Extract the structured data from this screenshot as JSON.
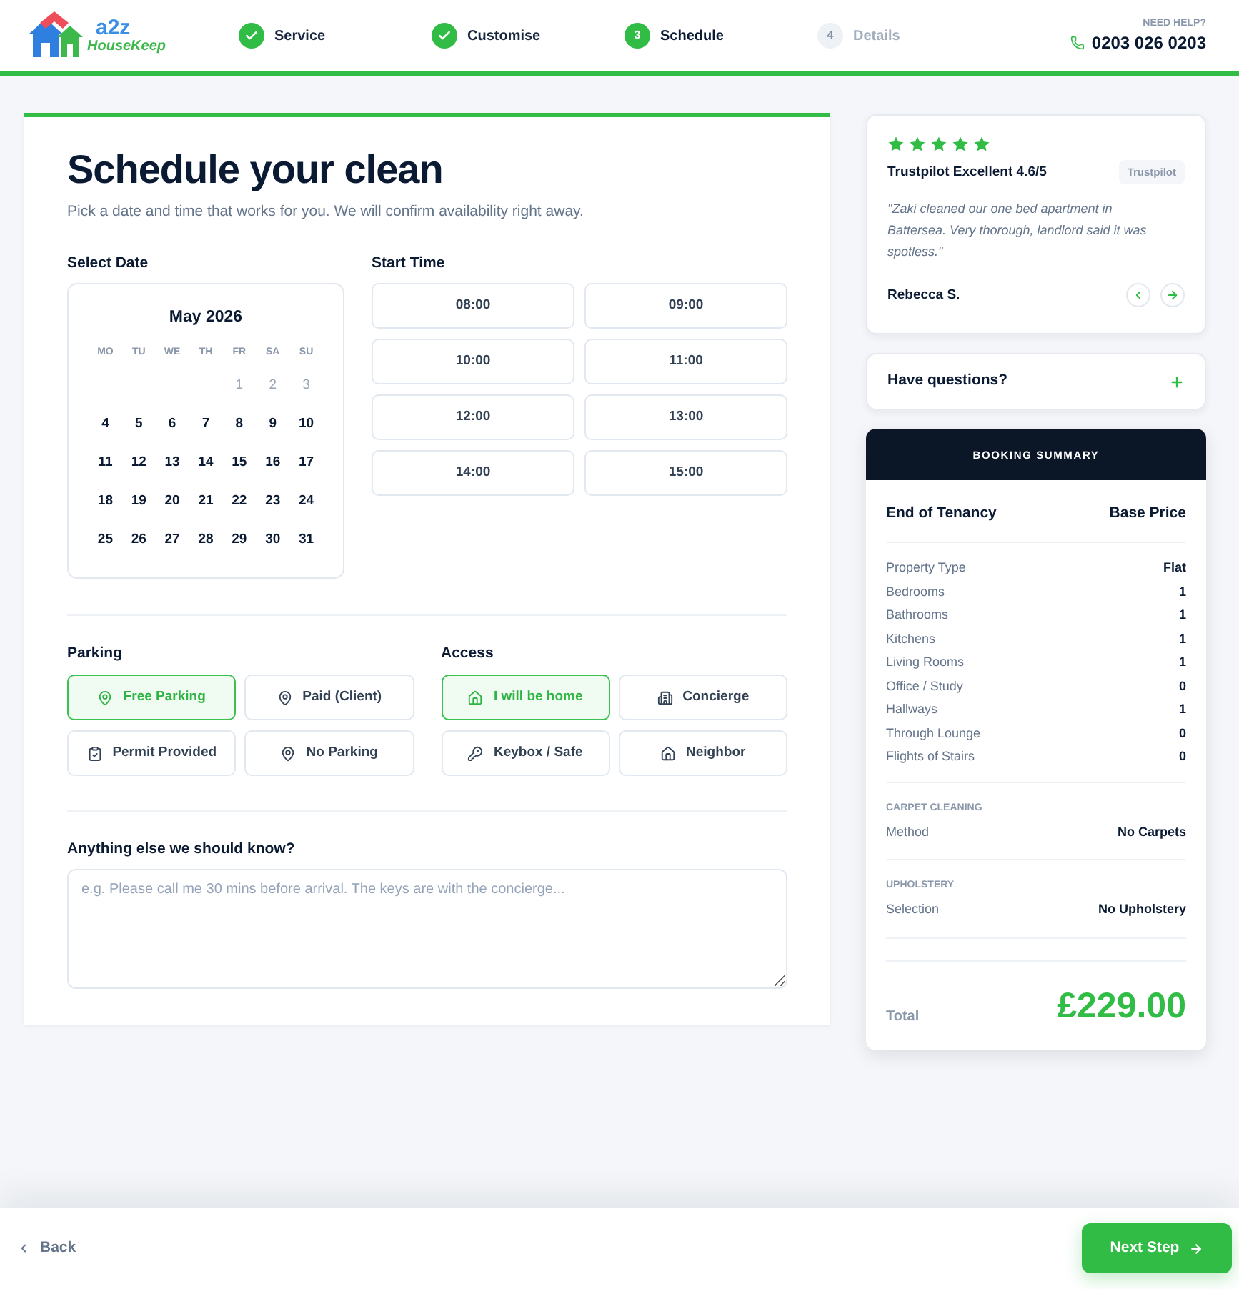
{
  "header": {
    "logo": {
      "mark": "a2z",
      "name": "HouseKeep"
    },
    "steps": [
      {
        "label": "Service",
        "completed": true,
        "selected": false
      },
      {
        "label": "Customise",
        "completed": true,
        "selected": false
      },
      {
        "number": "3",
        "label": "Schedule",
        "completed": false,
        "selected": true
      },
      {
        "number": "4",
        "label": "Details",
        "completed": false,
        "selected": false
      }
    ],
    "help": {
      "label": "NEED HELP?",
      "phone": "0203 026 0203"
    }
  },
  "schedule": {
    "title": "Schedule your clean",
    "subtitle": "Pick a date and time that works for you. We will confirm availability right away.",
    "date_label": "Select Date",
    "calendar": {
      "month": "May 2026",
      "weekdays": [
        "MO",
        "TU",
        "WE",
        "TH",
        "FR",
        "SA",
        "SU"
      ],
      "weeks": [
        [
          {
            "day": "1",
            "disabled": true
          },
          {
            "day": "2",
            "disabled": true
          },
          {
            "day": "3",
            "disabled": true
          }
        ],
        [
          {
            "day": "4",
            "disabled": false
          },
          {
            "day": "5",
            "disabled": false
          },
          {
            "day": "6",
            "disabled": false
          },
          {
            "day": "7",
            "disabled": false
          },
          {
            "day": "8",
            "disabled": false
          },
          {
            "day": "9",
            "disabled": false
          },
          {
            "day": "10",
            "disabled": false
          }
        ],
        [
          {
            "day": "11",
            "disabled": false
          },
          {
            "day": "12",
            "disabled": false
          },
          {
            "day": "13",
            "disabled": false
          },
          {
            "day": "14",
            "disabled": false
          },
          {
            "day": "15",
            "disabled": false
          },
          {
            "day": "16",
            "disabled": false
          },
          {
            "day": "17",
            "disabled": false
          }
        ],
        [
          {
            "day": "18",
            "disabled": false
          },
          {
            "day": "19",
            "disabled": false
          },
          {
            "day": "20",
            "disabled": false
          },
          {
            "day": "21",
            "disabled": false
          },
          {
            "day": "22",
            "disabled": false
          },
          {
            "day": "23",
            "disabled": false
          },
          {
            "day": "24",
            "disabled": false
          }
        ],
        [
          {
            "day": "25",
            "disabled": false
          },
          {
            "day": "26",
            "disabled": false
          },
          {
            "day": "27",
            "disabled": false
          },
          {
            "day": "28",
            "disabled": false
          },
          {
            "day": "29",
            "disabled": false
          },
          {
            "day": "30",
            "disabled": false
          },
          {
            "day": "31",
            "disabled": false
          }
        ]
      ]
    },
    "time_label": "Start Time",
    "times": [
      {
        "label": "08:00",
        "selected": false
      },
      {
        "label": "09:00",
        "selected": false
      },
      {
        "label": "10:00",
        "selected": false
      },
      {
        "label": "11:00",
        "selected": false
      },
      {
        "label": "12:00",
        "selected": false
      },
      {
        "label": "13:00",
        "selected": false
      },
      {
        "label": "14:00",
        "selected": false
      },
      {
        "label": "15:00",
        "selected": false
      }
    ]
  },
  "parking": {
    "label": "Parking",
    "options": [
      {
        "label": "Free Parking",
        "kind": "location",
        "selected": true
      },
      {
        "label": "Paid (Client)",
        "kind": "location",
        "selected": false
      },
      {
        "label": "Permit Provided",
        "kind": "permit",
        "selected": false
      },
      {
        "label": "No Parking",
        "kind": "location",
        "selected": false
      }
    ]
  },
  "access": {
    "label": "Access",
    "options": [
      {
        "label": "I will be home",
        "kind": "home",
        "selected": true
      },
      {
        "label": "Concierge",
        "kind": "building",
        "selected": false
      },
      {
        "label": "Keybox / Safe",
        "kind": "key",
        "selected": false
      },
      {
        "label": "Neighbor",
        "kind": "home",
        "selected": false
      }
    ]
  },
  "notes": {
    "label": "Anything else we should know?",
    "placeholder": "e.g. Please call me 30 mins before arrival. The keys are with the concierge..."
  },
  "review": {
    "stars": 5,
    "rating": "Trustpilot Excellent 4.6/5",
    "source": "Trustpilot",
    "quote": "\"Zaki cleaned our one bed apartment in Battersea. Very thorough, landlord said it was spotless.\"",
    "author": "Rebecca S."
  },
  "faq": {
    "label": "Have questions?",
    "expanded": false
  },
  "summary": {
    "title": "BOOKING SUMMARY",
    "service": "End of Tenancy",
    "price_label": "Base Price",
    "details": [
      {
        "label": "Property Type",
        "value": "Flat"
      },
      {
        "label": "Bedrooms",
        "value": "1"
      },
      {
        "label": "Bathrooms",
        "value": "1"
      },
      {
        "label": "Kitchens",
        "value": "1"
      },
      {
        "label": "Living Rooms",
        "value": "1"
      },
      {
        "label": "Office / Study",
        "value": "0"
      },
      {
        "label": "Hallways",
        "value": "1"
      },
      {
        "label": "Through Lounge",
        "value": "0"
      },
      {
        "label": "Flights of Stairs",
        "value": "0"
      }
    ],
    "sections": [
      {
        "heading": "CARPET CLEANING",
        "rows": [
          {
            "label": "Method",
            "value": "No Carpets"
          }
        ]
      },
      {
        "heading": "UPHOLSTERY",
        "rows": [
          {
            "label": "Selection",
            "value": "No Upholstery"
          }
        ]
      }
    ],
    "total_label": "Total",
    "total": "£229.00"
  },
  "footer": {
    "back": "Back",
    "next": "Next Step"
  }
}
